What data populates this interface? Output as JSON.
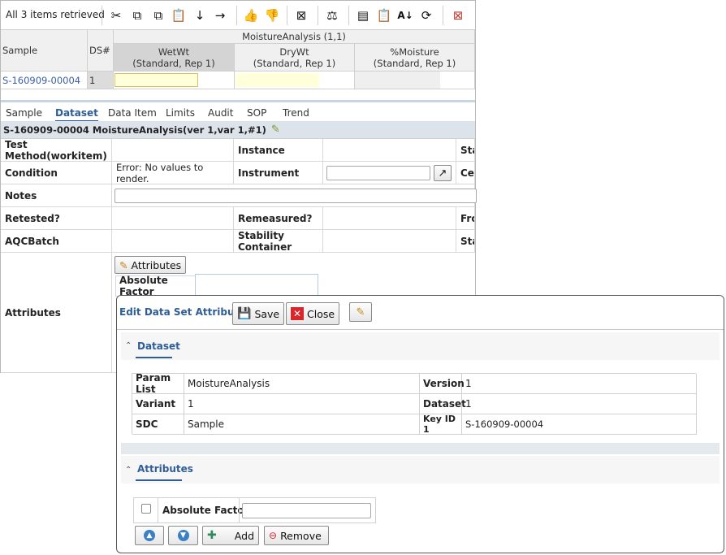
{
  "toolbar": {
    "items_retrieved": "All 3 items retrieved"
  },
  "grid": {
    "group_header": "MoistureAnalysis (1,1)",
    "col_sample": "Sample",
    "col_ds": "DS#",
    "columns": [
      {
        "name": "WetWt",
        "sub": "(Standard, Rep 1)"
      },
      {
        "name": "DryWt",
        "sub": "(Standard, Rep 1)"
      },
      {
        "name": "%Moisture",
        "sub": "(Standard, Rep 1)"
      }
    ],
    "row": {
      "sample": "S-160909-00004",
      "ds": "1"
    }
  },
  "tabs": [
    "Sample",
    "Dataset",
    "Data Item",
    "Limits",
    "Audit",
    "SOP",
    "Trend"
  ],
  "detail": {
    "title": "S-160909-00004 MoistureAnalysis(ver 1,var 1,#1)",
    "test_method_label": "Test Method(workitem)",
    "instance_label": "Instance",
    "sta_label": "Sta",
    "condition_label": "Condition",
    "condition_value": "Error: No values to render.",
    "instrument_label": "Instrument",
    "cer_label": "Cer",
    "notes_label": "Notes",
    "retested_label": "Retested?",
    "remeasured_label": "Remeasured?",
    "fro_label": "Fro",
    "aqcbatch_label": "AQCBatch",
    "stability_label": "Stability Container",
    "sta2_label": "Sta",
    "attributes_label": "Attributes",
    "attributes_button": "Attributes",
    "absolute_factor_label": "Absolute Factor"
  },
  "dialog": {
    "title": "Edit Data Set Attributes",
    "save_label": "Save",
    "close_label": "Close",
    "dataset_section": "Dataset",
    "fields": {
      "param_list_label": "Param List",
      "param_list_value": "MoistureAnalysis",
      "version_label": "Version",
      "version_value": "1",
      "variant_label": "Variant",
      "variant_value": "1",
      "dataset_label": "Dataset",
      "dataset_value": "1",
      "sdc_label": "SDC",
      "sdc_value": "Sample",
      "keyid_label": "Key ID 1",
      "keyid_value": "S-160909-00004"
    },
    "attributes_section": "Attributes",
    "absolute_factor_label": "Absolute Factor",
    "add_label": "Add",
    "remove_label": "Remove"
  },
  "colors": {
    "link": "#3a5fa8",
    "accent": "#2e5d98",
    "input_highlight": "#ffffd9",
    "error_red": "#d9262b"
  }
}
